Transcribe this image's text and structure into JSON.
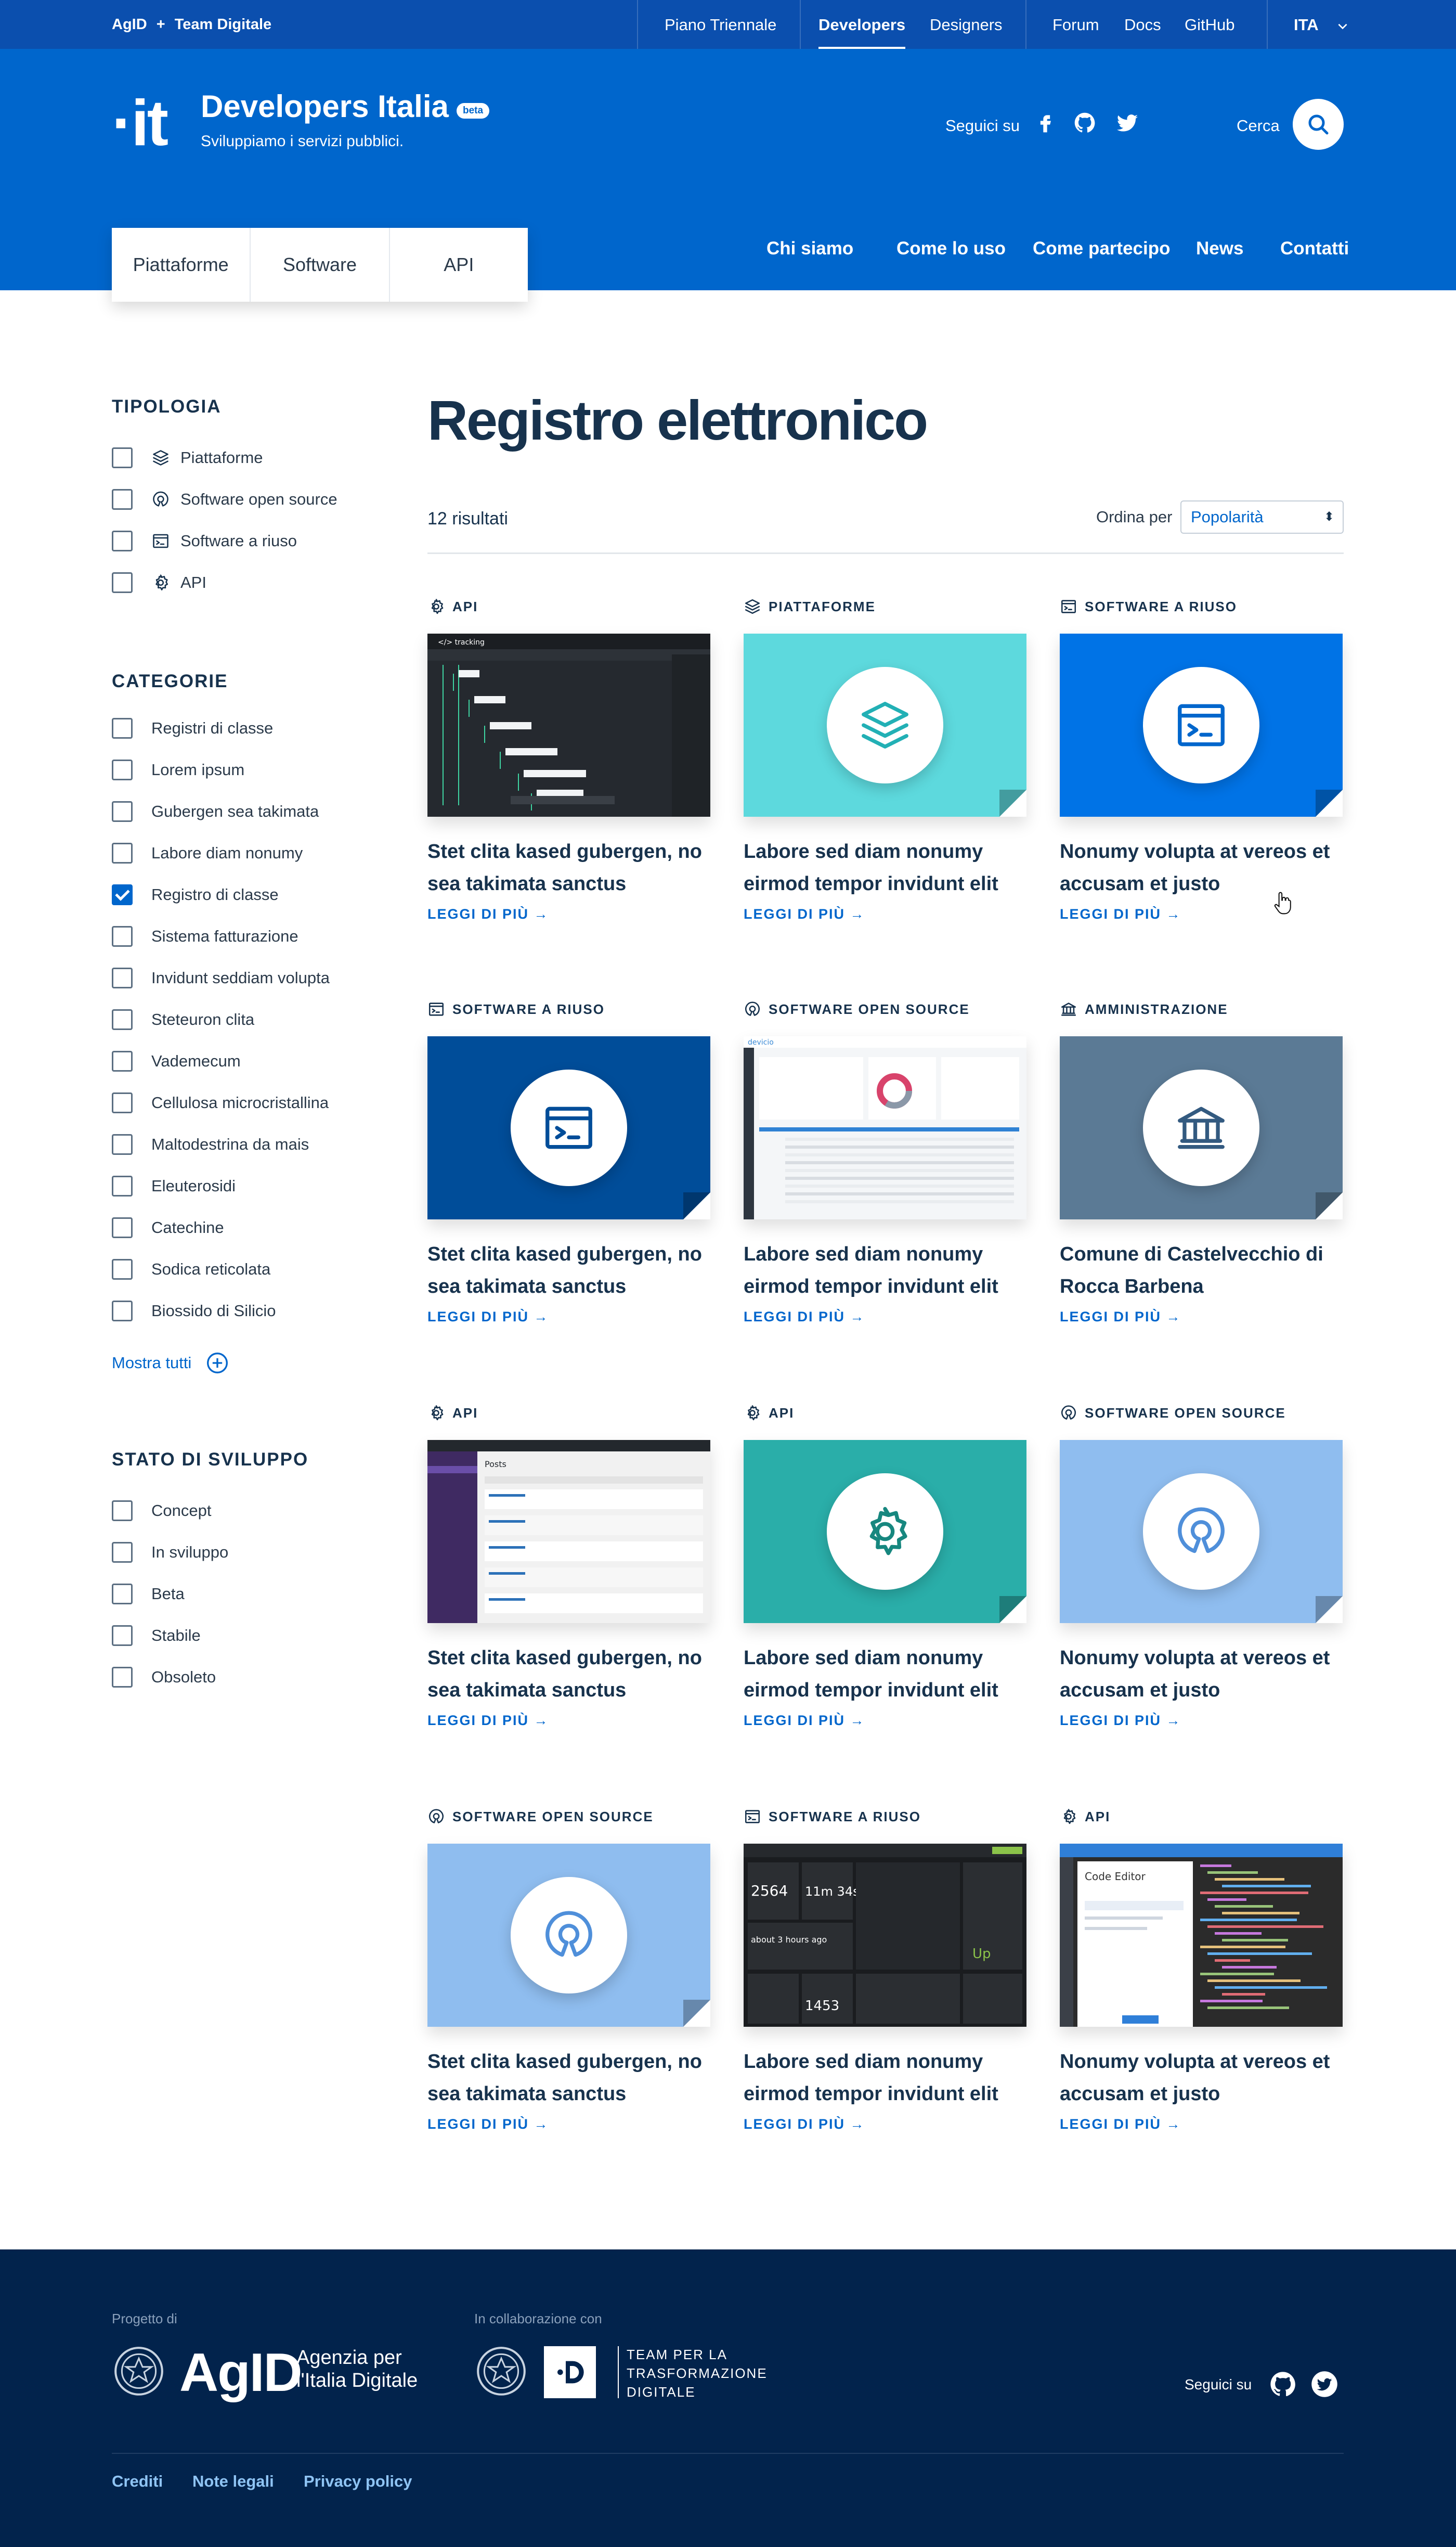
{
  "topbar": {
    "brand_left": "AgID",
    "brand_plus": "+",
    "brand_right": "Team Digitale",
    "links": [
      "Piano Triennale",
      "Developers",
      "Designers",
      "Forum",
      "Docs",
      "GitHub"
    ],
    "lang": "ITA"
  },
  "header": {
    "logo": "·it",
    "title": "Developers Italia",
    "beta": "beta",
    "tagline": "Sviluppiamo i servizi pubblici.",
    "follow": "Seguici su",
    "search_label": "Cerca",
    "tabs": [
      "Piattaforme",
      "Software",
      "API"
    ],
    "nav": [
      "Chi siamo",
      "Come lo uso",
      "Come partecipo",
      "News",
      "Contatti"
    ]
  },
  "sidebar": {
    "tipologia": {
      "title": "TIPOLOGIA",
      "items": [
        {
          "label": "Piattaforme",
          "icon": "layers-icon",
          "checked": false
        },
        {
          "label": "Software open source",
          "icon": "open-source-icon",
          "checked": false
        },
        {
          "label": "Software a riuso",
          "icon": "terminal-window-icon",
          "checked": false
        },
        {
          "label": "API",
          "icon": "gear-icon",
          "checked": false
        }
      ]
    },
    "categorie": {
      "title": "CATEGORIE",
      "items": [
        {
          "label": "Registri di classe",
          "checked": false
        },
        {
          "label": "Lorem ipsum",
          "checked": false
        },
        {
          "label": "Gubergen sea takimata",
          "checked": false
        },
        {
          "label": "Labore diam nonumy",
          "checked": false
        },
        {
          "label": "Registro di classe",
          "checked": true
        },
        {
          "label": "Sistema fatturazione",
          "checked": false
        },
        {
          "label": "Invidunt seddiam volupta",
          "checked": false
        },
        {
          "label": "Steteuron clita",
          "checked": false
        },
        {
          "label": "Vademecum",
          "checked": false
        },
        {
          "label": "Cellulosa microcristallina",
          "checked": false
        },
        {
          "label": "Maltodestrina da mais",
          "checked": false
        },
        {
          "label": "Eleuterosidi",
          "checked": false
        },
        {
          "label": "Catechine",
          "checked": false
        },
        {
          "label": "Sodica reticolata",
          "checked": false
        },
        {
          "label": "Biossido di Silicio",
          "checked": false
        }
      ],
      "show_all": "Mostra tutti"
    },
    "stato": {
      "title": "STATO DI SVILUPPO",
      "items": [
        {
          "label": "Concept",
          "checked": false
        },
        {
          "label": "In sviluppo",
          "checked": false
        },
        {
          "label": "Beta",
          "checked": false
        },
        {
          "label": "Stabile",
          "checked": false
        },
        {
          "label": "Obsoleto",
          "checked": false
        }
      ]
    }
  },
  "main": {
    "title": "Registro elettronico",
    "results": "12 risultati",
    "order_label": "Ordina per",
    "order_value": "Popolarità",
    "read_more": "LEGGI DI PIÙ →",
    "cards": [
      {
        "cat": "API",
        "cat_icon": "gear-icon",
        "title_1": "Stet clita kased gubergen, no",
        "title_2": "sea takimata sanctus",
        "image": "screenshot-dark-gantt"
      },
      {
        "cat": "PIATTAFORME",
        "cat_icon": "layers-icon",
        "title_1": "Labore sed diam nonumy",
        "title_2": "eirmod tempor invidunt elit",
        "image": "layers-icon",
        "color": "#5dd9dd",
        "icon_color": "#22b0b5"
      },
      {
        "cat": "SOFTWARE A RIUSO",
        "cat_icon": "terminal-window-icon",
        "title_1": "Nonumy volupta at vereos et",
        "title_2": "accusam et justo",
        "image": "terminal-window-icon",
        "color": "#0073e6",
        "icon_color": "#0066cc"
      },
      {
        "cat": "SOFTWARE A RIUSO",
        "cat_icon": "terminal-window-icon",
        "title_1": "Stet clita kased gubergen, no",
        "title_2": "sea takimata sanctus",
        "image": "terminal-window-icon",
        "color": "#004d99",
        "icon_color": "#004d99"
      },
      {
        "cat": "SOFTWARE OPEN SOURCE",
        "cat_icon": "open-source-icon",
        "title_1": "Labore sed diam nonumy",
        "title_2": "eirmod tempor invidunt elit",
        "image": "screenshot-dashboard"
      },
      {
        "cat": "AMMINISTRAZIONE",
        "cat_icon": "institution-icon",
        "title_1": "Comune di Castelvecchio di",
        "title_2": "Rocca Barbena",
        "image": "institution-icon",
        "color": "#5b7a95",
        "icon_color": "#335a80"
      },
      {
        "cat": "API",
        "cat_icon": "gear-icon",
        "title_1": "Stet clita kased gubergen, no",
        "title_2": "sea takimata sanctus",
        "image": "screenshot-wp-admin"
      },
      {
        "cat": "API",
        "cat_icon": "gear-icon",
        "title_1": "Labore sed diam nonumy",
        "title_2": "eirmod tempor invidunt elit",
        "image": "gear-icon",
        "color": "#2aaea9",
        "icon_color": "#17877f"
      },
      {
        "cat": "SOFTWARE OPEN SOURCE",
        "cat_icon": "open-source-icon",
        "title_1": "Nonumy volupta at vereos et",
        "title_2": "accusam et justo",
        "image": "open-source-icon",
        "color": "#8fbdef",
        "icon_color": "#4f8fda"
      },
      {
        "cat": "SOFTWARE OPEN SOURCE",
        "cat_icon": "open-source-icon",
        "title_1": "Stet clita kased gubergen, no",
        "title_2": "sea takimata sanctus",
        "image": "open-source-icon",
        "color": "#8fbdef",
        "icon_color": "#4f8fda"
      },
      {
        "cat": "SOFTWARE A RIUSO",
        "cat_icon": "terminal-window-icon",
        "title_1": "Labore sed diam nonumy",
        "title_2": "eirmod tempor invidunt elit",
        "image": "screenshot-dark-stats",
        "stats": [
          "2564",
          "11m 34s",
          "about 3 hours ago",
          "1453",
          "Up"
        ]
      },
      {
        "cat": "API",
        "cat_icon": "gear-icon",
        "title_1": "Nonumy volupta at vereos et",
        "title_2": "accusam et justo",
        "image": "screenshot-code-editor",
        "editor_title": "Code Editor"
      }
    ]
  },
  "footer": {
    "project_of": "Progetto di",
    "agid": "AgID",
    "agid_sub_1": "Agenzia per",
    "agid_sub_2": "l'Italia Digitale",
    "collab": "In collaborazione con",
    "team_1": "TEAM PER LA",
    "team_2": "TRASFORMAZIONE",
    "team_3": "DIGITALE",
    "follow": "Seguici su",
    "links": [
      "Crediti",
      "Note legali",
      "Privacy policy"
    ]
  }
}
